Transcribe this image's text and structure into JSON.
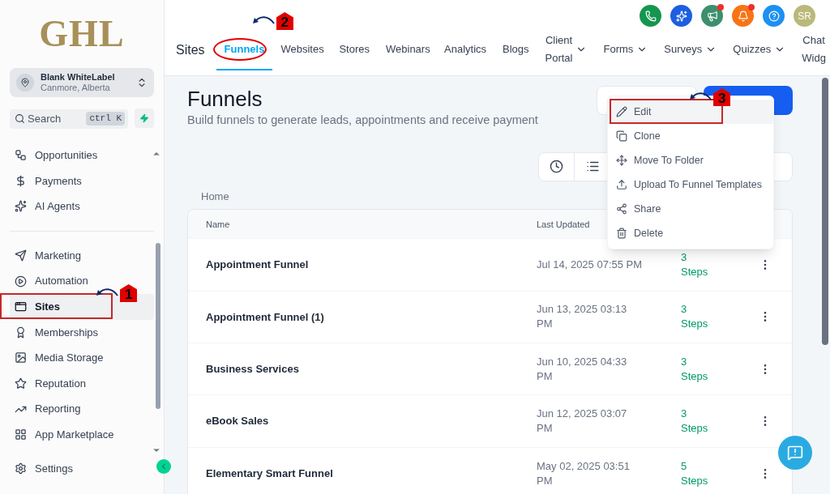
{
  "sidebar": {
    "logo": "GHL",
    "account": {
      "name": "Blank WhiteLabel",
      "location": "Canmore, Alberta"
    },
    "search": {
      "placeholder": "Search",
      "shortcut": "ctrl K"
    },
    "groups": [
      [
        {
          "label": "Opportunities",
          "selected": false
        },
        {
          "label": "Payments",
          "selected": false
        },
        {
          "label": "AI Agents",
          "selected": false
        }
      ],
      [
        {
          "label": "Marketing",
          "selected": false
        },
        {
          "label": "Automation",
          "selected": false
        },
        {
          "label": "Sites",
          "selected": true,
          "annotation": "1"
        },
        {
          "label": "Memberships",
          "selected": false
        },
        {
          "label": "Media Storage",
          "selected": false
        },
        {
          "label": "Reputation",
          "selected": false
        },
        {
          "label": "Reporting",
          "selected": false
        },
        {
          "label": "App Marketplace",
          "selected": false
        }
      ]
    ],
    "footer": {
      "label": "Settings"
    }
  },
  "header": {
    "section": "Sites",
    "tabs": [
      {
        "label": "Funnels",
        "selected": true,
        "annotation": "2"
      },
      {
        "label": "Websites",
        "selected": false
      },
      {
        "label": "Stores",
        "selected": false
      },
      {
        "label": "Webinars",
        "selected": false
      },
      {
        "label": "Analytics",
        "selected": false
      },
      {
        "label": "Blogs",
        "selected": false
      },
      {
        "label": "Client Portal",
        "selected": false,
        "dropdown": true
      },
      {
        "label": "Forms",
        "selected": false,
        "dropdown": true
      },
      {
        "label": "Surveys",
        "selected": false,
        "dropdown": true
      },
      {
        "label": "Quizzes",
        "selected": false,
        "dropdown": true
      },
      {
        "label": "Chat Widg",
        "selected": false,
        "dropdown": false
      }
    ],
    "actions": [
      {
        "kind": "phone",
        "color": "#14964f",
        "dot": false
      },
      {
        "kind": "sparkle",
        "color": "#1d5fe0",
        "dot": false
      },
      {
        "kind": "megaphone",
        "color": "#3d8f6e",
        "dot": true
      },
      {
        "kind": "bell",
        "color": "#f97316",
        "dot": true
      },
      {
        "kind": "help",
        "color": "#1e90f0",
        "dot": false
      },
      {
        "kind": "avatar",
        "color": "#b9b97a",
        "initials": "SR",
        "dot": false
      }
    ]
  },
  "page": {
    "title": "Funnels",
    "subtitle": "Build funnels to generate leads, appointments and receive payment",
    "breadcrumb": "Home",
    "table": {
      "columns": [
        "Name",
        "Last Updated"
      ],
      "rows": [
        {
          "name": "Appointment Funnel",
          "updated": "Jul 14, 2025 07:55 PM",
          "count": "3",
          "unit": "Steps"
        },
        {
          "name": "Appointment Funnel (1)",
          "updated": "Jun 13, 2025 03:13 PM",
          "count": "3",
          "unit": "Steps"
        },
        {
          "name": "Business Services",
          "updated": "Jun 10, 2025 04:33 PM",
          "count": "3",
          "unit": "Steps"
        },
        {
          "name": "eBook Sales",
          "updated": "Jun 12, 2025 03:07 PM",
          "count": "3",
          "unit": "Steps"
        },
        {
          "name": "Elementary Smart Funnel",
          "updated": "May 02, 2025 03:51 PM",
          "count": "5",
          "unit": "Steps"
        }
      ]
    }
  },
  "context_menu": [
    {
      "label": "Edit",
      "selected": true,
      "annotation": "3"
    },
    {
      "label": "Clone",
      "selected": false
    },
    {
      "label": "Move To Folder",
      "selected": false
    },
    {
      "label": "Upload To Funnel Templates",
      "selected": false
    },
    {
      "label": "Share",
      "selected": false
    },
    {
      "label": "Delete",
      "selected": false
    }
  ]
}
